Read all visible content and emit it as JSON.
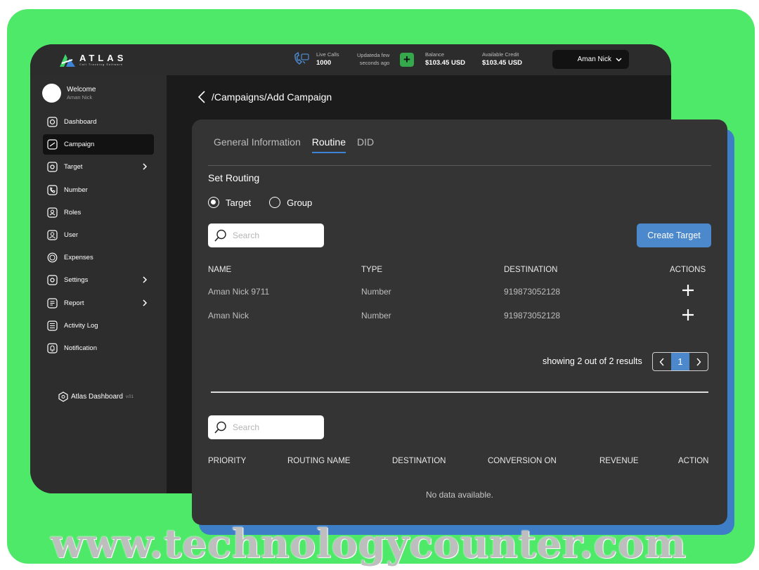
{
  "brand": {
    "name": "ATLAS",
    "tagline": "Call Tracking Software"
  },
  "header": {
    "live_calls_label": "Live Calls",
    "live_calls_value": "1000",
    "updated_line1": "Updateda few",
    "updated_line2": "seconds ago",
    "balance_label": "Balance",
    "balance_value": "$103.45 USD",
    "credit_label": "Available Credit",
    "credit_value": "$103.45 USD",
    "user_name": "Aman Nick"
  },
  "sidebar": {
    "welcome": "Welcome",
    "user": "Aman Nick",
    "items": [
      {
        "label": "Dashboard"
      },
      {
        "label": "Campaign"
      },
      {
        "label": "Target"
      },
      {
        "label": "Number"
      },
      {
        "label": "Roles"
      },
      {
        "label": "User"
      },
      {
        "label": "Expenses"
      },
      {
        "label": "Settings"
      },
      {
        "label": "Report"
      },
      {
        "label": "Activity Log"
      },
      {
        "label": "Notification"
      }
    ],
    "footer": "Atlas Dashboard",
    "version": "v.01"
  },
  "breadcrumb": "/Campaigns/Add Campaign",
  "tabs": [
    "General Information",
    "Routine",
    "DID"
  ],
  "routing": {
    "title": "Set Routing",
    "options": [
      "Target",
      "Group"
    ],
    "search_placeholder": "Search",
    "create_button": "Create Target",
    "columns": [
      "NAME",
      "TYPE",
      "DESTINATION",
      "ACTIONS"
    ],
    "rows": [
      {
        "name": "Aman Nick 9711",
        "type": "Number",
        "destination": "919873052128"
      },
      {
        "name": "Aman Nick",
        "type": "Number",
        "destination": "919873052128"
      }
    ],
    "pagination_text": "showing 2 out of 2 results",
    "current_page": "1"
  },
  "routes": {
    "search_placeholder": "Search",
    "columns": [
      "PRIORITY",
      "ROUTING NAME",
      "DESTINATION",
      "CONVERSION ON",
      "REVENUE",
      "ACTION"
    ],
    "empty_text": "No data available."
  },
  "watermark": "www.technologycounter.com",
  "colors": {
    "green_bg": "#4ee968",
    "accent_blue": "#4c88cc",
    "success": "#34a84a"
  }
}
